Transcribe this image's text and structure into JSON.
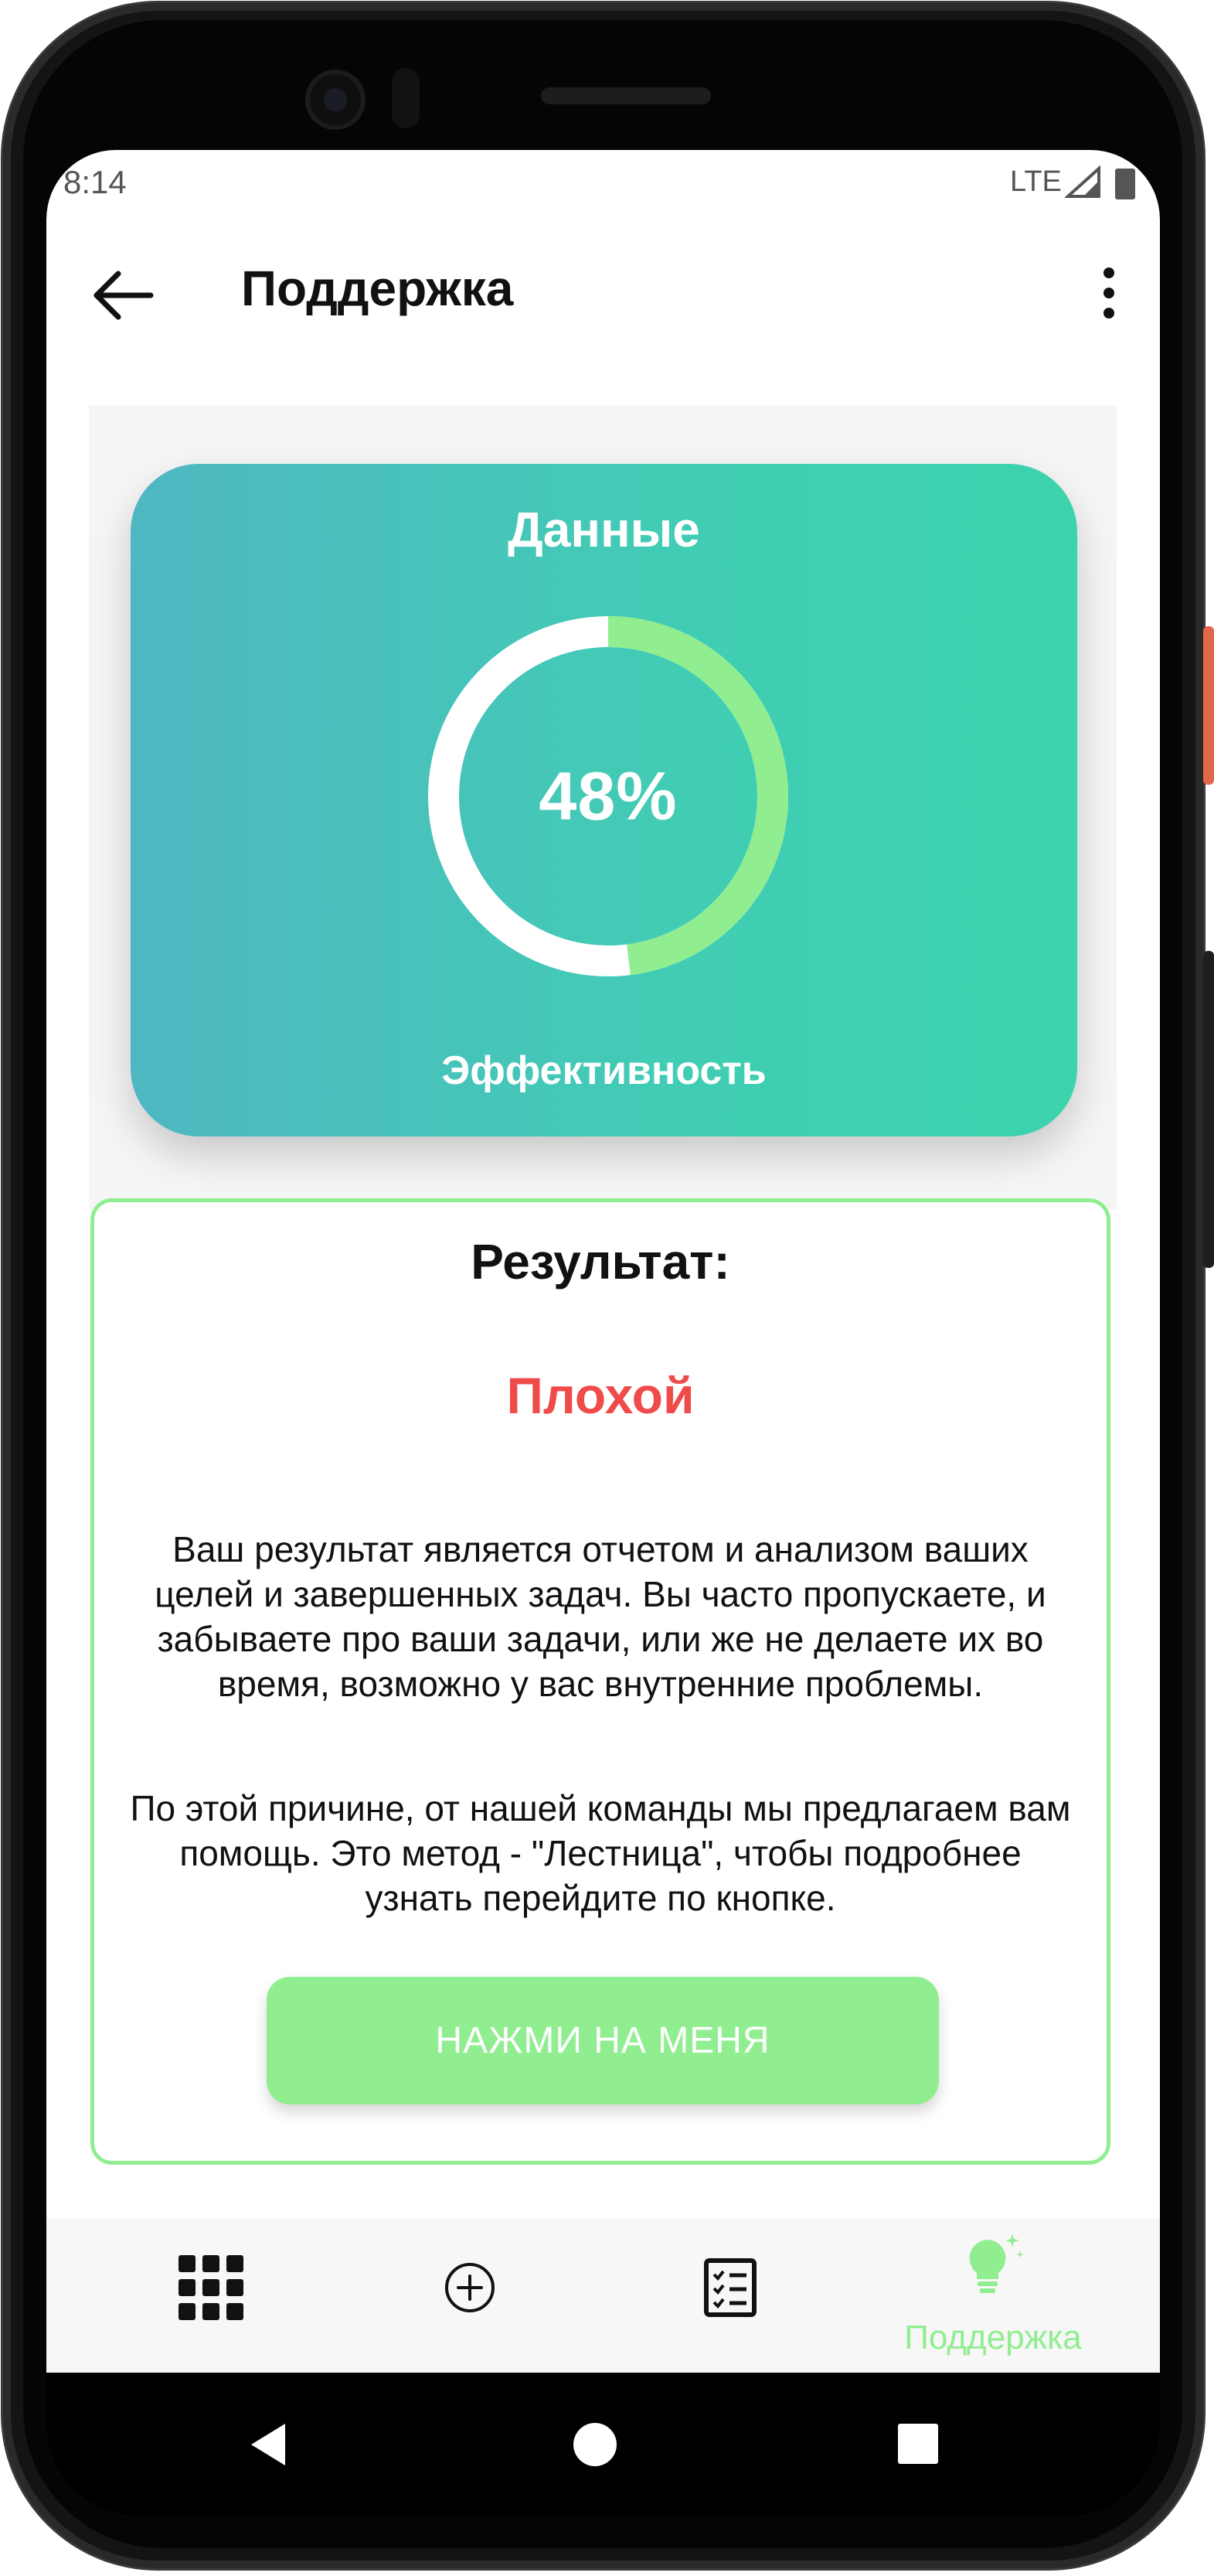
{
  "status_bar": {
    "time": "8:14",
    "network": "LTE"
  },
  "app_bar": {
    "title": "Поддержка"
  },
  "card": {
    "title": "Данные",
    "progress_percent": 48,
    "progress_label": "48%",
    "caption": "Эффективность",
    "ring_color": "#90ee90",
    "ring_track_color": "#ffffff"
  },
  "result": {
    "title": "Результат:",
    "grade": "Плохой",
    "grade_color": "#f04b4b",
    "paragraph1": "Ваш результат является отчетом и анализом ваших целей и завершенных задач. Вы часто пропускаете, и забываете про ваши задачи, или же не делаете их во время, возможно у вас внутренние проблемы.",
    "paragraph2": "По этой причине, от нашей команды мы предлагаем вам помощь. Это метод - \"Лестница\", чтобы подробнее узнать перейдите по кнопке.",
    "button_label": "НАЖМИ НА МЕНЯ"
  },
  "bottom_nav": {
    "items": [
      {
        "icon": "grid-icon",
        "label": ""
      },
      {
        "icon": "add-circle-icon",
        "label": ""
      },
      {
        "icon": "checklist-icon",
        "label": ""
      },
      {
        "icon": "lightbulb-icon",
        "label": "Поддержка",
        "active": true
      }
    ],
    "active_color": "#90ee90"
  },
  "colors": {
    "accent": "#90ee90",
    "card_gradient_start": "#4fb7c2",
    "card_gradient_end": "#3cd3ad"
  }
}
